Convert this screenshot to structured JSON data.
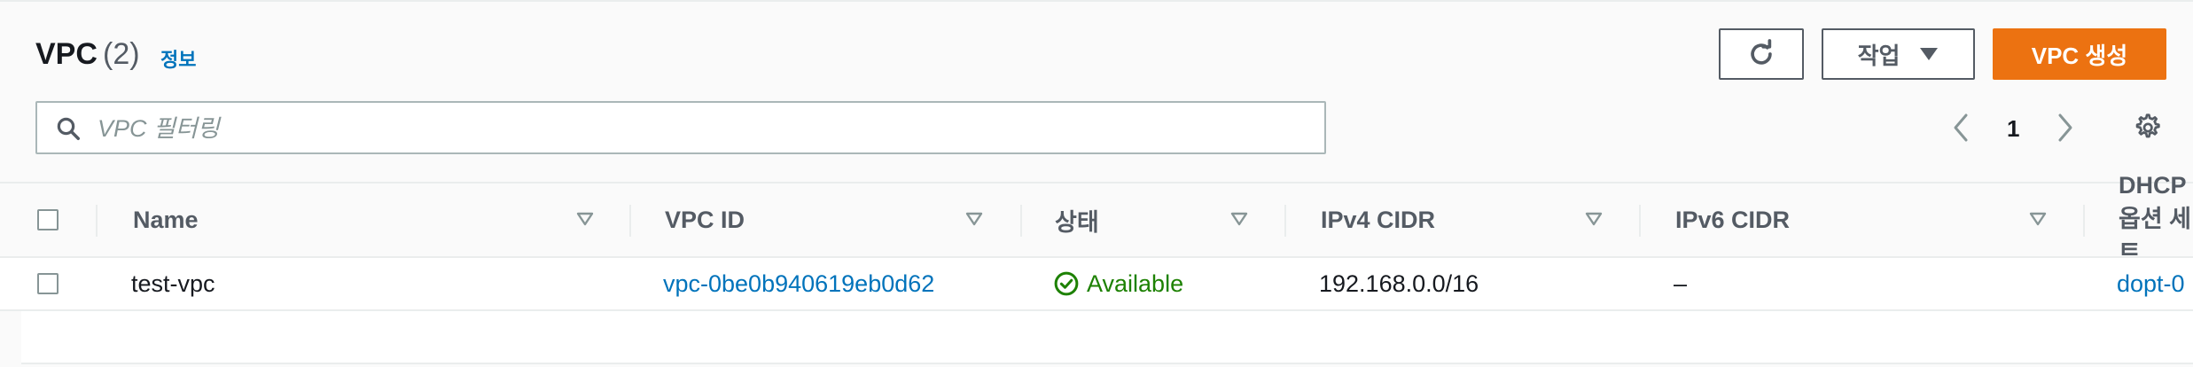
{
  "header": {
    "title": "VPC",
    "count": "(2)",
    "info_link": "정보"
  },
  "toolbar": {
    "actions_label": "작업",
    "create_label": "VPC 생성"
  },
  "search": {
    "placeholder": "VPC 필터링",
    "value": ""
  },
  "pagination": {
    "current_page": "1"
  },
  "table": {
    "columns": [
      "Name",
      "VPC ID",
      "상태",
      "IPv4 CIDR",
      "IPv6 CIDR",
      "DHCP 옵션 세트"
    ],
    "rows": [
      {
        "name": "test-vpc",
        "vpc_id": "vpc-0be0b940619eb0d62",
        "status": "Available",
        "ipv4_cidr": "192.168.0.0/16",
        "ipv6_cidr": "–",
        "dhcp": "dopt-0"
      }
    ]
  },
  "colors": {
    "accent": "#ec7211",
    "link": "#0073bb",
    "success": "#1d8102"
  }
}
